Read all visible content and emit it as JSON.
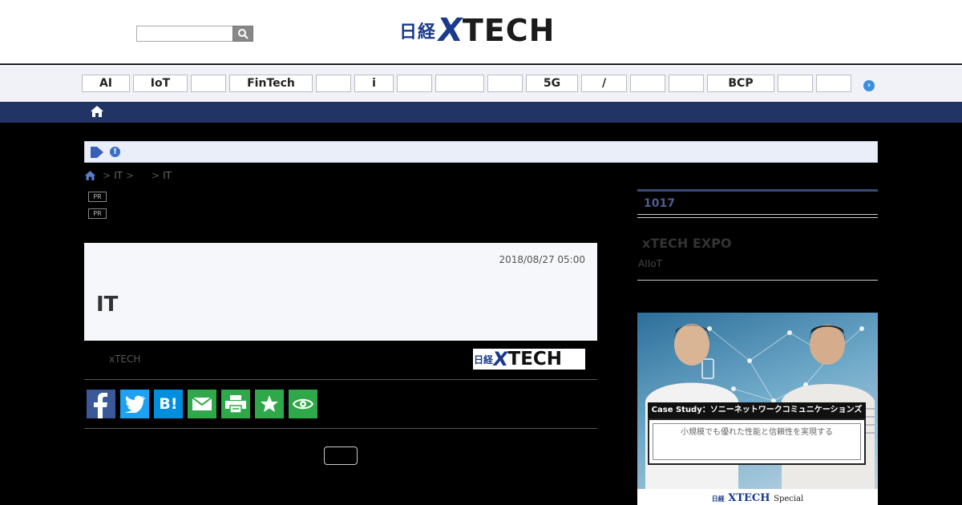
{
  "header": {
    "search": {
      "value": "",
      "placeholder": ""
    },
    "logo_jp": "日経",
    "logo_x": "X",
    "logo_tech": "TECH"
  },
  "tag_nav": {
    "tags": [
      {
        "label": "AI"
      },
      {
        "label": "IoT"
      },
      {
        "label": ""
      },
      {
        "label": "FinTech"
      },
      {
        "label": ""
      },
      {
        "label": "i"
      },
      {
        "label": ""
      },
      {
        "label": ""
      },
      {
        "label": ""
      },
      {
        "label": "5G"
      },
      {
        "label": "/"
      },
      {
        "label": ""
      },
      {
        "label": ""
      },
      {
        "label": "BCP"
      },
      {
        "label": ""
      },
      {
        "label": ""
      }
    ],
    "next_icon": "›"
  },
  "notice": {
    "excl": "!"
  },
  "breadcrumb": {
    "sep1": ">",
    "item1": "IT",
    "sep2": ">",
    "sep3": ">",
    "item3": "IT"
  },
  "pr": [
    "PR",
    "PR"
  ],
  "article": {
    "date": "2018/08/27 05:00",
    "title": "IT",
    "byline": "xTECH"
  },
  "share": {
    "buttons": [
      {
        "name": "facebook-icon",
        "color": "#3b5998"
      },
      {
        "name": "twitter-icon",
        "color": "#1da1f2"
      },
      {
        "name": "hatena-icon",
        "color": "#008fde"
      },
      {
        "name": "mail-icon",
        "color": "#2ea849"
      },
      {
        "name": "print-icon",
        "color": "#2ea849"
      },
      {
        "name": "star-icon",
        "color": "#2ea849"
      },
      {
        "name": "view-icon",
        "color": "#2ea849"
      }
    ],
    "hatena_label": "B!"
  },
  "sidebar": {
    "rank": "1017",
    "expo_title": "xTECH EXPO",
    "expo_sub": "AIIoT"
  },
  "ad": {
    "banner": "Case Study：ソニーネットワークコミュニケーションズ",
    "sub": "小規模でも優れた性能と信頼性を実現する",
    "foot_jp": "日経",
    "foot_x": "XTECH",
    "foot_special": "Special"
  }
}
